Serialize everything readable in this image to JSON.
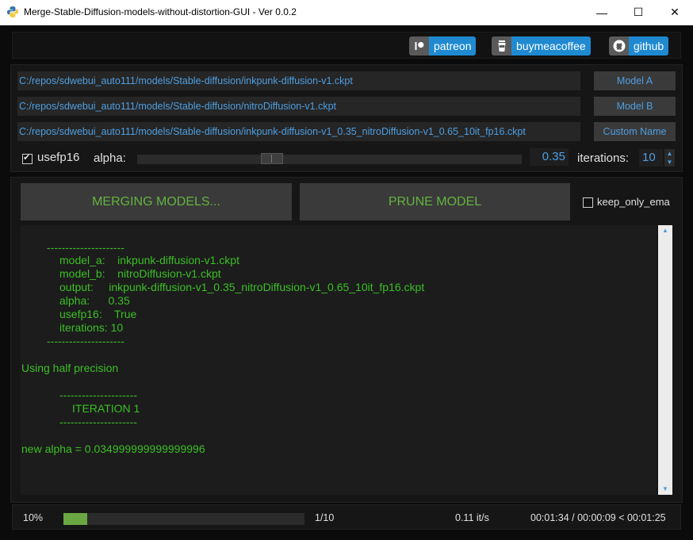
{
  "window": {
    "title": "Merge-Stable-Diffusion-models-without-distortion-GUI - Ver 0.0.2",
    "controls": {
      "minimize": "—",
      "maximize": "☐",
      "close": "✕"
    }
  },
  "links": [
    {
      "label": "patreon",
      "icon": "patreon-icon"
    },
    {
      "label": "buymeacoffee",
      "icon": "coffee-cup-icon"
    },
    {
      "label": "github",
      "icon": "github-icon"
    }
  ],
  "models": {
    "model_a": {
      "path": "C:/repos/sdwebui_auto111/models/Stable-diffusion/inkpunk-diffusion-v1.ckpt",
      "button": "Model A"
    },
    "model_b": {
      "path": "C:/repos/sdwebui_auto111/models/Stable-diffusion/nitroDiffusion-v1.ckpt",
      "button": "Model B"
    },
    "custom": {
      "path": "C:/repos/sdwebui_auto111/models/Stable-diffusion/inkpunk-diffusion-v1_0.35_nitroDiffusion-v1_0.65_10it_fp16.ckpt",
      "button": "Custom Name"
    }
  },
  "options": {
    "usefp16_label": "usefp16",
    "usefp16_checked": true,
    "alpha_label": "alpha:",
    "alpha_value": "0.35",
    "alpha_fraction": 0.35,
    "iterations_label": "iterations:",
    "iterations_value": "10"
  },
  "actions": {
    "merge_label": "MERGING MODELS...",
    "prune_label": "PRUNE MODEL",
    "keep_only_ema_label": "keep_only_ema",
    "keep_only_ema_checked": false
  },
  "console_lines": [
    "---------------------",
    "model_a:    inkpunk-diffusion-v1.ckpt",
    "model_b:    nitroDiffusion-v1.ckpt",
    "output:     inkpunk-diffusion-v1_0.35_nitroDiffusion-v1_0.65_10it_fp16.ckpt",
    "alpha:      0.35",
    "usefp16:    True",
    "iterations: 10",
    "---------------------",
    "Using half precision",
    "---------------------",
    "ITERATION 1",
    "---------------------",
    "new alpha = 0.034999999999999996"
  ],
  "status": {
    "percent": "10%",
    "progress_fraction": 0.1,
    "count": "1/10",
    "rate": "0.11 it/s",
    "time": "00:01:34 / 00:00:09 < 00:01:25"
  },
  "colors": {
    "accent_blue": "#1f8ad1",
    "text_blue": "#4e9ee0",
    "console_green": "#3bbf25",
    "progress_green": "#6aa642"
  }
}
